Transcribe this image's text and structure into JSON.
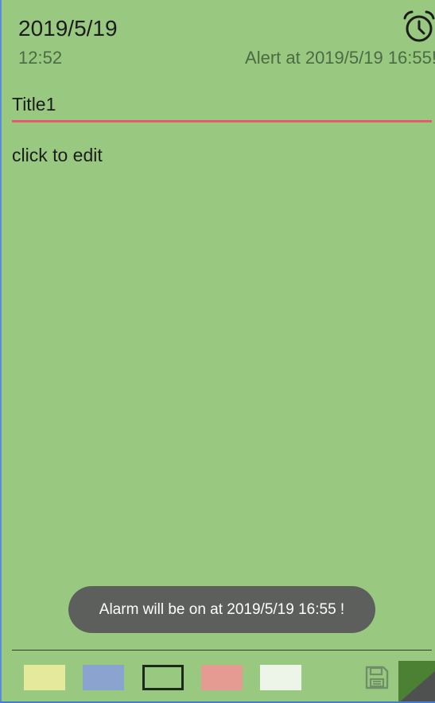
{
  "header": {
    "date": "2019/5/19",
    "time": "12:52",
    "alert": "Alert at 2019/5/19 16:55!",
    "alarm_icon": "alarm-clock-icon"
  },
  "note": {
    "title": "Title1",
    "body": "click to edit",
    "underline_color": "#e85874",
    "background_color": "#99c981"
  },
  "toast": {
    "message": "Alarm will be on at 2019/5/19 16:55 !"
  },
  "toolbar": {
    "swatches": [
      {
        "name": "yellow",
        "color": "#e5e99c"
      },
      {
        "name": "blue",
        "color": "#8ba4cf"
      },
      {
        "name": "green",
        "color": "#99c981"
      },
      {
        "name": "red",
        "color": "#e59b92"
      },
      {
        "name": "white",
        "color": "#edf4e8"
      }
    ],
    "selected": "green",
    "save_icon": "save-icon"
  }
}
